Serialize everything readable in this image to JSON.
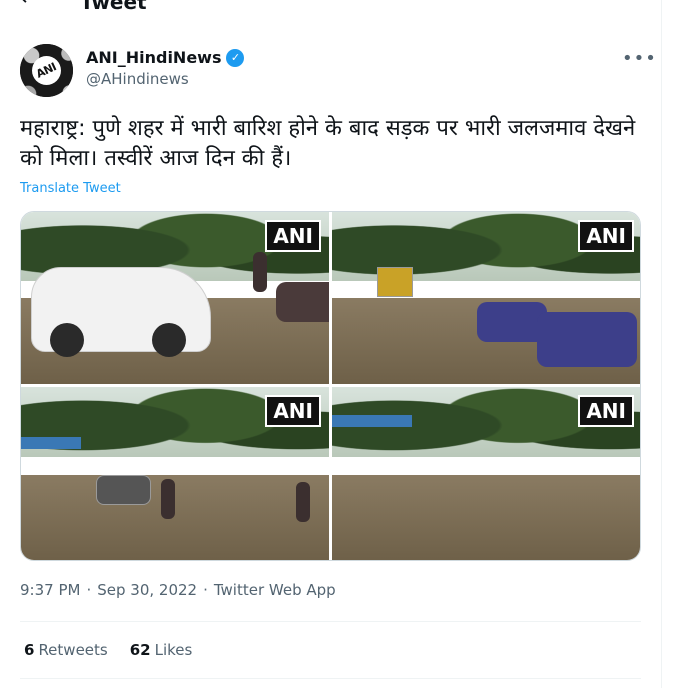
{
  "header": {
    "back_glyph": "←",
    "title": "Tweet"
  },
  "author": {
    "display_name": "ANI_HindiNews",
    "handle": "@AHindinews",
    "verified_glyph": "✓",
    "avatar_text": "ANI"
  },
  "more_glyph": "•••",
  "tweet": {
    "text": "महाराष्ट्र: पुणे शहर में भारी बारिश होने के बाद सड़क पर भारी जलजमाव देखने को मिला। तस्वीरें आज दिन की हैं।",
    "translate_label": "Translate Tweet"
  },
  "media": {
    "watermark": "ANI",
    "photos": [
      "photo-flooded-street-car",
      "photo-flooded-street-scooters",
      "photo-flooded-road-trees",
      "photo-flooded-road-truck"
    ]
  },
  "meta": {
    "time": "9:37 PM",
    "separator": "·",
    "date": "Sep 30, 2022",
    "source": "Twitter Web App"
  },
  "stats": {
    "retweets_count": "6",
    "retweets_label": "Retweets",
    "likes_count": "62",
    "likes_label": "Likes"
  },
  "colors": {
    "accent": "#1d9bf0",
    "text": "#0f1419",
    "muted": "#536471"
  }
}
